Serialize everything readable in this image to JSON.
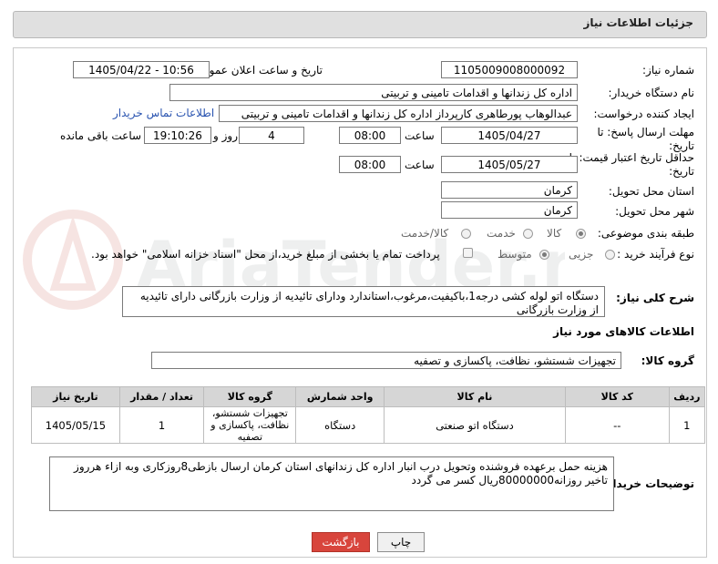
{
  "header": {
    "title": "جزئیات اطلاعات نیاز"
  },
  "fields": {
    "need_number_label": "شماره نیاز:",
    "need_number": "1105009008000092",
    "announce_label": "تاریخ و ساعت اعلان عمومی:",
    "announce_value": "1405/04/22 - 10:56",
    "buyer_label": "نام دستگاه خریدار:",
    "buyer_value": "اداره کل زندانها و اقدامات تامینی و تربیتی",
    "creator_label": "ایجاد کننده درخواست:",
    "creator_value": "عبدالوهاب پورطاهری کارپرداز اداره کل زندانها و اقدامات تامینی و تربیتی",
    "contact_link": "اطلاعات تماس خریدار",
    "deadline_label": "مهلت ارسال پاسخ: تا تاریخ:",
    "deadline_date": "1405/04/27",
    "time_label": "ساعت",
    "deadline_time": "08:00",
    "days_value": "4",
    "days_label": "روز و",
    "remaining_time": "19:10:26",
    "remaining_label": "ساعت باقی مانده",
    "price_validity_label": "حداقل تاریخ اعتبار قیمت: تا تاریخ:",
    "price_validity_date": "1405/05/27",
    "price_validity_time": "08:00",
    "province_label": "استان محل تحویل:",
    "province_value": "کرمان",
    "city_label": "شهر محل تحویل:",
    "city_value": "کرمان",
    "category_label": "طبقه بندی موضوعی:",
    "category_options": [
      "کالا",
      "خدمت",
      "کالا/خدمت"
    ],
    "category_selected": "کالا",
    "process_label": "نوع فرآیند خرید :",
    "process_options": [
      "جزیی",
      "متوسط"
    ],
    "process_selected": "متوسط",
    "payment_note": "پرداخت تمام یا بخشی از مبلغ خرید،از محل \"اسناد خزانه اسلامی\" خواهد بود.",
    "description_label": "شرح کلی نیاز:",
    "description_value": "دستگاه اتو لوله کشی درجه1،باکیفیت،مرغوب،استاندارد ودارای تائیدیه از وزارت بازرگانی دارای تائیدیه از وزارت بازرگانی",
    "goods_info_title": "اطلاعات کالاهای مورد نیاز",
    "goods_group_label": "گروه کالا:",
    "goods_group_value": "تجهیزات شستشو، نظافت، پاکسازی و تصفیه"
  },
  "table": {
    "headers": [
      "ردیف",
      "کد کالا",
      "نام کالا",
      "واحد شمارش",
      "گروه کالا",
      "تعداد / مقدار",
      "تاریخ نیاز"
    ],
    "rows": [
      [
        "1",
        "--",
        "دستگاه اتو صنعتی",
        "دستگاه",
        "تجهیزات شستشو، نظافت، پاکسازی و تصفیه",
        "1",
        "1405/05/15"
      ]
    ]
  },
  "buyer_notes": {
    "label": "توضیحات خریدار:",
    "value": "هزینه حمل برعهده فروشنده وتحویل درب انبار اداره کل زندانهای استان کرمان ارسال بازطی8روزکاری وبه ازاء هرروز تاخیر روزانه80000000ریال کسر می گردد"
  },
  "buttons": {
    "print": "چاپ",
    "back": "بازگشت"
  },
  "watermark": {
    "text": "AriaTender.neT"
  },
  "colors": {
    "link": "#2a54b0",
    "back_button": "#d8453c",
    "header_bg": "#e0e0e0",
    "table_header": "#d6d6d6"
  }
}
